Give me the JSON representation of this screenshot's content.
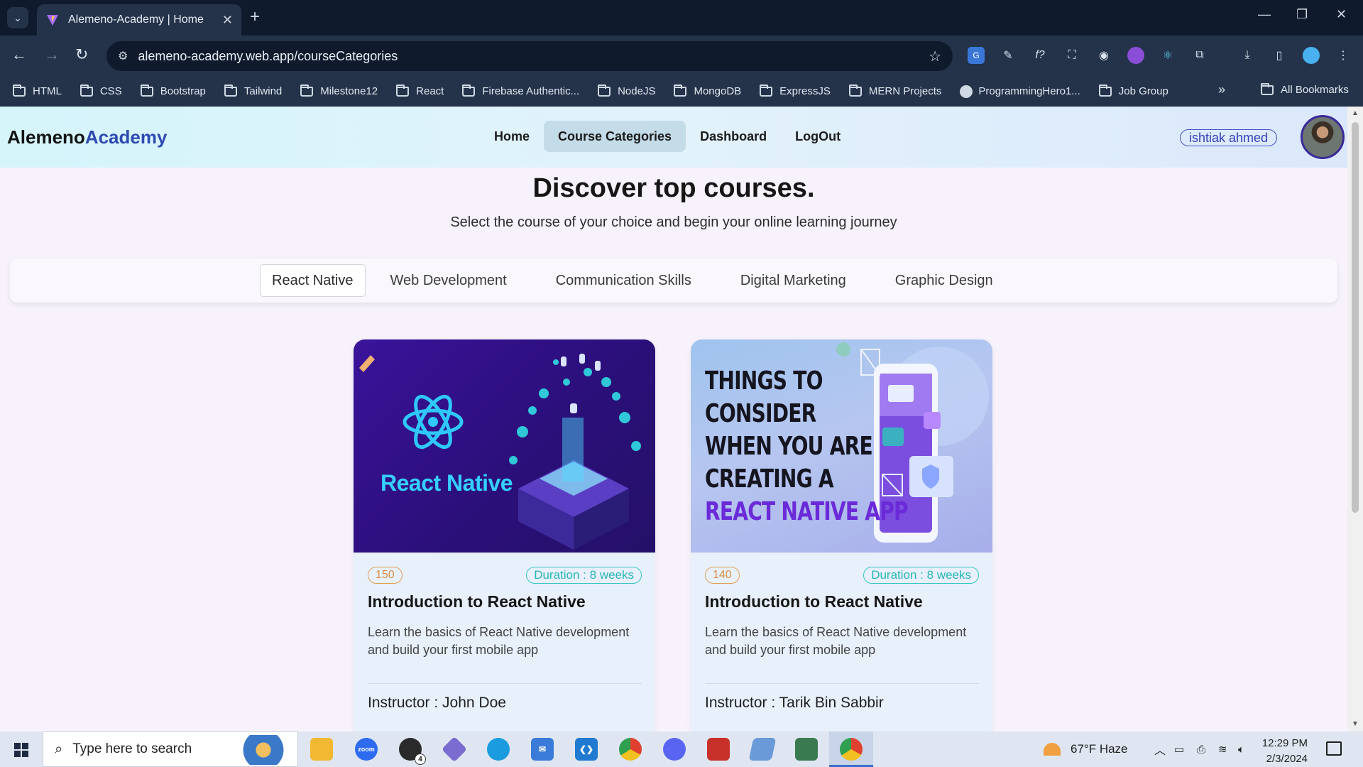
{
  "browser": {
    "tab_title": "Alemeno-Academy | Home",
    "url": "alemeno-academy.web.app/courseCategories",
    "bookmarks": [
      "HTML",
      "CSS",
      "Bootstrap",
      "Tailwind",
      "Milestone12",
      "React",
      "Firebase Authentic...",
      "NodeJS",
      "MongoDB",
      "ExpressJS",
      "MERN Projects",
      "ProgrammingHero1...",
      "Job Group"
    ],
    "all_bookmarks": "All Bookmarks"
  },
  "navbar": {
    "logo_main": "Alemeno",
    "logo_accent": "Academy",
    "menu": [
      "Home",
      "Course Categories",
      "Dashboard",
      "LogOut"
    ],
    "active_menu": "Course Categories",
    "user_name": "ishtiak ahmed"
  },
  "hero": {
    "title": "Discover top courses.",
    "subtitle": "Select the course of your choice and begin your online learning journey"
  },
  "categories": {
    "items": [
      "React Native",
      "Web Development",
      "Communication Skills",
      "Digital Marketing",
      "Graphic Design"
    ],
    "active": "React Native"
  },
  "courses": [
    {
      "image_text": "React Native",
      "count": "150",
      "duration": "Duration : 8 weeks",
      "title": "Introduction to React Native",
      "description": "Learn the basics of React Native development and build your first mobile app",
      "instructor": "Instructor : John Doe"
    },
    {
      "image_lines": [
        "THINGS TO",
        "CONSIDER",
        "WHEN YOU ARE",
        "CREATING A",
        "REACT NATIVE APP"
      ],
      "count": "140",
      "duration": "Duration : 8 weeks",
      "title": "Introduction to React Native",
      "description": "Learn the basics of React Native development and build your first mobile app",
      "instructor": "Instructor : Tarik Bin Sabbir"
    }
  ],
  "taskbar": {
    "search_placeholder": "Type here to search",
    "weather": "67°F  Haze",
    "time": "12:29 PM",
    "date": "2/3/2024",
    "whatsapp_badge": "4"
  },
  "colors": {
    "logo_accent": "#2f4ab0",
    "count_badge": "#d89040",
    "duration_badge": "#29b6b6",
    "card_bg": "#e8f0fb"
  }
}
